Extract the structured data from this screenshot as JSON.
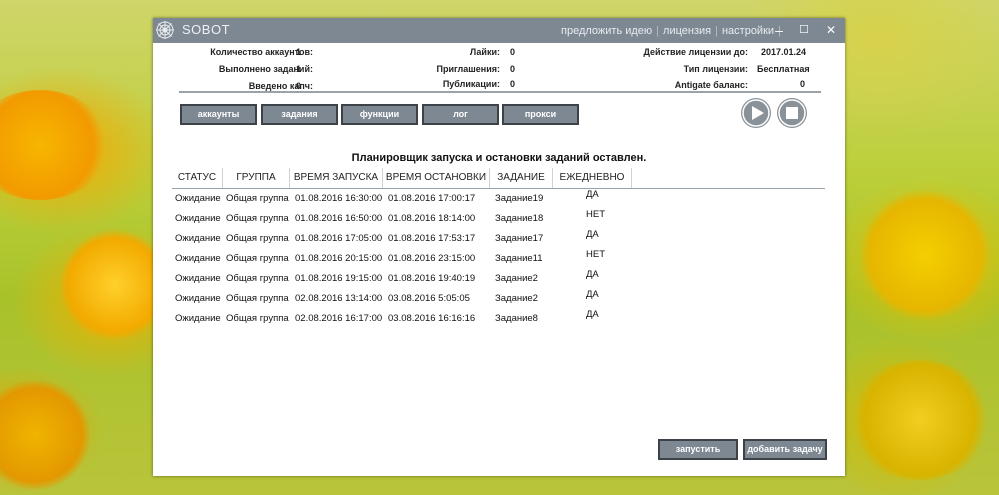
{
  "window": {
    "title": "SOBOT",
    "title_links": [
      "предложить идею",
      "лицензия",
      "настройки"
    ],
    "controls": {
      "minimize": "–",
      "maximize": "☐",
      "close": "✕"
    }
  },
  "stats": {
    "accounts_label": "Количество аккаунтов:",
    "accounts_value": "1",
    "tasks_done_label": "Выполнено заданий:",
    "tasks_done_value": "1",
    "captcha_label": "Введено капч:",
    "captcha_value": "0",
    "likes_label": "Лайки:",
    "likes_value": "0",
    "invites_label": "Приглашения:",
    "invites_value": "0",
    "posts_label": "Публикации:",
    "posts_value": "0",
    "license_until_label": "Действие лицензии до:",
    "license_until_value": "2017.01.24",
    "license_type_label": "Тип лицензии:",
    "license_type_value": "Бесплатная",
    "antigate_label": "Antigate баланс:",
    "antigate_value": "0"
  },
  "nav": {
    "accounts": "аккаунты",
    "tasks": "задания",
    "functions": "функции",
    "log": "лог",
    "proxy": "прокси"
  },
  "scheduler_status": "Планировщик запуска и остановки заданий оставлен.",
  "table": {
    "headers": [
      "СТАТУС",
      "ГРУППА",
      "ВРЕМЯ ЗАПУСКА",
      "ВРЕМЯ ОСТАНОВКИ",
      "ЗАДАНИЕ",
      "ЕЖЕДНЕВНО"
    ],
    "rows": [
      [
        "Ожидание",
        "Общая группа",
        "01.08.2016 16:30:00",
        "01.08.2016 17:00:17",
        "Задание19",
        "ДА"
      ],
      [
        "Ожидание",
        "Общая группа",
        "01.08.2016 16:50:00",
        "01.08.2016 18:14:00",
        "Задание18",
        "НЕТ"
      ],
      [
        "Ожидание",
        "Общая группа",
        "01.08.2016 17:05:00",
        "01.08.2016 17:53:17",
        "Задание17",
        "ДА"
      ],
      [
        "Ожидание",
        "Общая группа",
        "01.08.2016 20:15:00",
        "01.08.2016 23:15:00",
        "Задание11",
        "НЕТ"
      ],
      [
        "Ожидание",
        "Общая группа",
        "01.08.2016 19:15:00",
        "01.08.2016 19:40:19",
        "Задание2",
        "ДА"
      ],
      [
        "Ожидание",
        "Общая группа",
        "02.08.2016 13:14:00",
        "03.08.2016 5:05:05",
        "Задание2",
        "ДА"
      ],
      [
        "Ожидание",
        "Общая группа",
        "02.08.2016 16:17:00",
        "03.08.2016 16:16:16",
        "Задание8",
        "ДА"
      ]
    ]
  },
  "actions": {
    "run": "запустить",
    "add_task": "добавить задачу"
  },
  "icons": {
    "logo": "spider-web-icon",
    "play": "play-icon",
    "stop": "stop-icon"
  },
  "colors": {
    "titlebar": "#7e8893",
    "button": "#7e8893",
    "button_border": "#3c4248"
  }
}
